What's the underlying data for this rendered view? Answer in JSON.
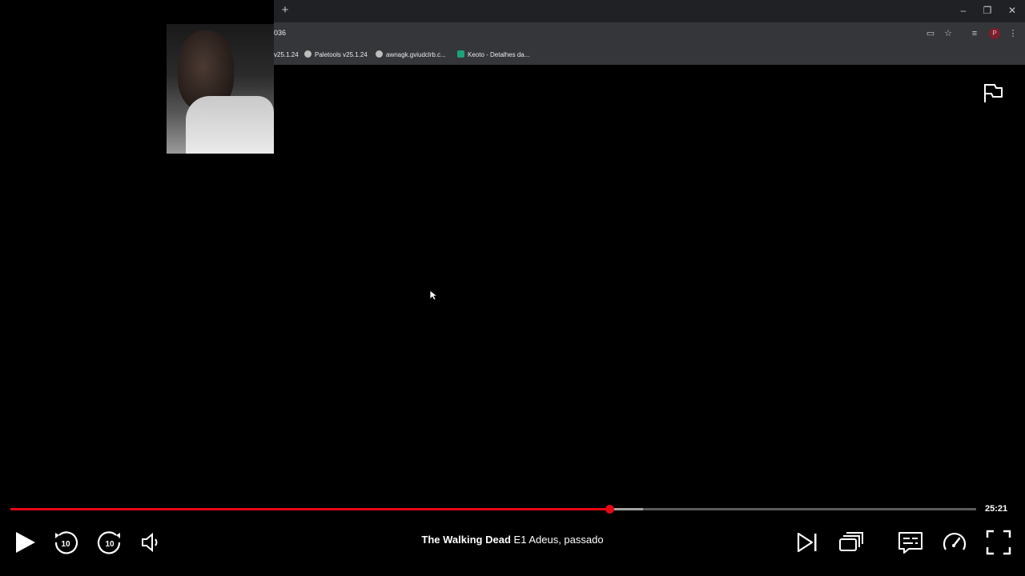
{
  "browser": {
    "url": "036",
    "bookmarks": [
      {
        "label": "v25.1.24"
      },
      {
        "label": "Paletools v25.1.24"
      },
      {
        "label": "awnagk.gviudclrb.c..."
      },
      {
        "label": "Keoto - Detalhes da..."
      }
    ],
    "profile_initial": "P"
  },
  "player": {
    "show_title": "The Walking Dead",
    "episode": "E1",
    "episode_title": "Adeus, passado",
    "time_remaining": "25:21",
    "progress_fraction": 0.62,
    "buffered_fraction": 0.655,
    "accent_color": "#e50914"
  },
  "icons": [
    "flag-icon",
    "play-icon",
    "rewind-10-icon",
    "forward-10-icon",
    "volume-icon",
    "next-episode-icon",
    "episodes-icon",
    "subtitles-icon",
    "playback-speed-icon",
    "fullscreen-icon"
  ]
}
